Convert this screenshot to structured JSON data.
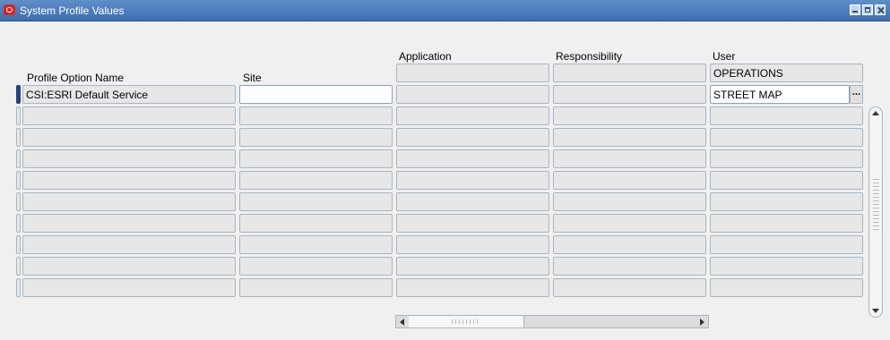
{
  "window": {
    "title": "System Profile Values"
  },
  "headers": {
    "profile_option_name": "Profile Option Name",
    "site": "Site",
    "application": "Application",
    "responsibility": "Responsibility",
    "user": "User"
  },
  "context": {
    "user_value": "OPERATIONS"
  },
  "rows": [
    {
      "profile_option_name": "CSI:ESRI Default Service",
      "site": "",
      "application": "",
      "responsibility": "",
      "user": "STREET MAP"
    },
    {
      "profile_option_name": "",
      "site": "",
      "application": "",
      "responsibility": "",
      "user": ""
    },
    {
      "profile_option_name": "",
      "site": "",
      "application": "",
      "responsibility": "",
      "user": ""
    },
    {
      "profile_option_name": "",
      "site": "",
      "application": "",
      "responsibility": "",
      "user": ""
    },
    {
      "profile_option_name": "",
      "site": "",
      "application": "",
      "responsibility": "",
      "user": ""
    },
    {
      "profile_option_name": "",
      "site": "",
      "application": "",
      "responsibility": "",
      "user": ""
    },
    {
      "profile_option_name": "",
      "site": "",
      "application": "",
      "responsibility": "",
      "user": ""
    },
    {
      "profile_option_name": "",
      "site": "",
      "application": "",
      "responsibility": "",
      "user": ""
    },
    {
      "profile_option_name": "",
      "site": "",
      "application": "",
      "responsibility": "",
      "user": ""
    },
    {
      "profile_option_name": "",
      "site": "",
      "application": "",
      "responsibility": "",
      "user": ""
    }
  ],
  "lov_button_label": "...",
  "icons": {
    "app": "oracle-logo-icon",
    "minimize": "minimize-icon",
    "maximize": "maximize-icon",
    "close": "close-icon"
  }
}
